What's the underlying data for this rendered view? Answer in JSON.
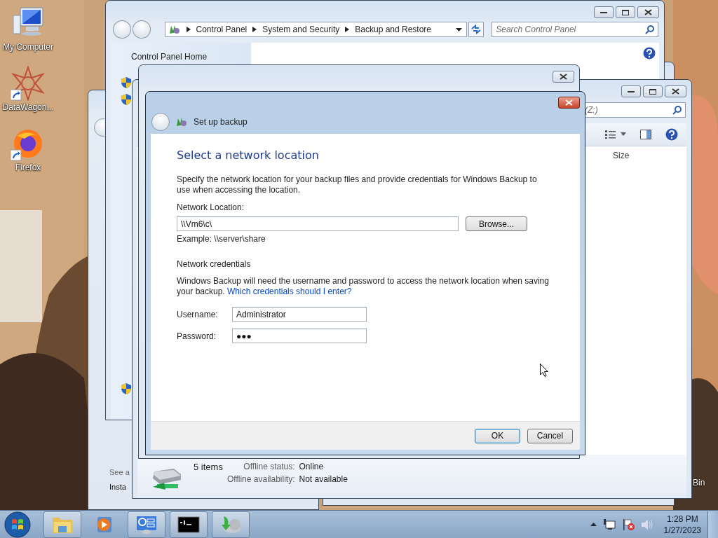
{
  "desktop_icons": [
    {
      "kind": "computer",
      "label": "My Computer",
      "shortcut": false
    },
    {
      "kind": "emblem",
      "label": "DataWagon...",
      "shortcut": true
    },
    {
      "kind": "browser",
      "label": "Firefox",
      "shortcut": true
    }
  ],
  "desktop_edge_label": "Bin",
  "back_window": {
    "links": [
      "See a",
      "Insta"
    ]
  },
  "control_panel": {
    "breadcrumb": [
      "Control Panel",
      "System and Security",
      "Backup and Restore"
    ],
    "search": {
      "placeholder": "Search Control Panel"
    },
    "sidebar": {
      "home_link": "Control Panel Home"
    }
  },
  "explorer": {
    "search": {
      "placeholder": "(Z:)"
    },
    "column_header": "Size",
    "status": {
      "count": "5 items",
      "fields": [
        {
          "label": "Offline status:",
          "value": "Online"
        },
        {
          "label": "Offline availability:",
          "value": "Not available"
        }
      ]
    }
  },
  "dialog": {
    "title": "Set up backup",
    "heading": "Select a network location",
    "intro": "Specify the network location for your backup files and provide credentials for Windows Backup to use when accessing the location.",
    "location_label": "Network Location:",
    "location_value": "\\\\Vm6\\c\\",
    "browse": "Browse...",
    "example": "Example: \\\\server\\share",
    "credentials_heading": "Network credentials",
    "credentials_text": "Windows Backup will need the username and password to access the network location when saving your backup.",
    "credentials_link": "Which credentials should I enter?",
    "fields": [
      {
        "label": "Username:",
        "value": "Administrator"
      },
      {
        "label": "Password:",
        "value": "●●●"
      }
    ],
    "buttons": [
      {
        "label": "OK",
        "default": true
      },
      {
        "label": "Cancel",
        "default": false
      }
    ]
  },
  "taskbar": {
    "buttons": [
      {
        "kind": "folder",
        "framed": true
      },
      {
        "kind": "media",
        "framed": false
      },
      {
        "kind": "panel",
        "framed": true
      },
      {
        "kind": "prompt",
        "framed": true
      },
      {
        "kind": "backup",
        "framed": true
      }
    ],
    "clock": {
      "time": "1:28 PM",
      "date": "1/27/2023"
    }
  }
}
